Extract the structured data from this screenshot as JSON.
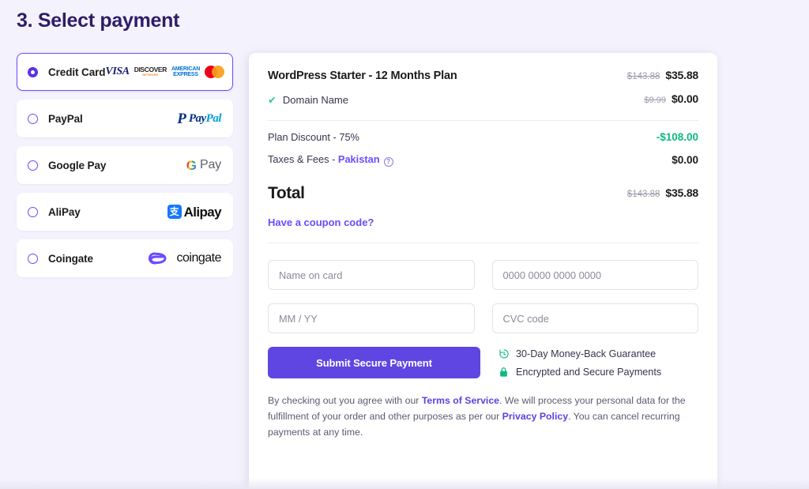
{
  "page": {
    "title": "3. Select payment",
    "accent_purple": "#6d4aff",
    "title_color": "#2f1c6a",
    "background": "#f4f3fd",
    "success_green": "#10b981"
  },
  "payment_methods": [
    {
      "id": "credit-card",
      "label": "Credit Card",
      "selected": true,
      "logo": "card-brands"
    },
    {
      "id": "paypal",
      "label": "PayPal",
      "selected": false,
      "logo": "paypal"
    },
    {
      "id": "google-pay",
      "label": "Google Pay",
      "selected": false,
      "logo": "google-pay"
    },
    {
      "id": "alipay",
      "label": "AliPay",
      "selected": false,
      "logo": "alipay"
    },
    {
      "id": "coingate",
      "label": "Coingate",
      "selected": false,
      "logo": "coingate"
    }
  ],
  "card_brands": [
    {
      "name": "visa",
      "text": "VISA"
    },
    {
      "name": "discover",
      "text": "DISCOVER",
      "subtext": "NETWORK"
    },
    {
      "name": "american-express",
      "line1": "AMERICAN",
      "line2": "EXPRESS"
    },
    {
      "name": "mastercard",
      "text": ""
    }
  ],
  "brand_words": {
    "paypal_a": "Pay",
    "paypal_b": "Pal",
    "paypal_mark": "P",
    "google_mark": "G",
    "google_pay": "Pay",
    "alipay_mark": "支",
    "alipay_word": "Alipay",
    "coingate_word": "coingate"
  },
  "summary": {
    "plan": {
      "name": "WordPress Starter - 12 Months Plan",
      "price_old": "$143.88",
      "price_new": "$35.88"
    },
    "addon": {
      "check": "✔",
      "name": "Domain Name",
      "price_old": "$9.99",
      "price_new": "$0.00"
    },
    "lines": [
      {
        "label": "Plan Discount - 75%",
        "amount": "-$108.00",
        "discount": true
      },
      {
        "label_prefix": "Taxes & Fees - ",
        "link": "Pakistan",
        "info_icon": "?",
        "amount": "$0.00",
        "discount": false
      }
    ],
    "total": {
      "label": "Total",
      "price_old": "$143.88",
      "price_new": "$35.88"
    },
    "coupon_link": "Have a coupon code?"
  },
  "card_form": {
    "name_on_card_placeholder": "Name on card",
    "card_number_placeholder": "0000 0000 0000 0000",
    "expiry_placeholder": "MM / YY",
    "cvc_placeholder": "CVC code",
    "name_on_card_value": "",
    "card_number_value": "",
    "expiry_value": "",
    "cvc_value": "",
    "submit_label": "Submit Secure Payment"
  },
  "assurances": [
    {
      "icon": "clock-refresh-icon",
      "text": "30-Day Money-Back Guarantee"
    },
    {
      "icon": "lock-icon",
      "text": "Encrypted and Secure Payments"
    }
  ],
  "legal": {
    "part1": "By checking out you agree with our ",
    "terms_link": "Terms of Service",
    "part2": ". We will process your personal data for the fulfillment of your order and other purposes as per our ",
    "privacy_link": "Privacy Policy",
    "part3": ". You can cancel recurring payments at any time."
  }
}
